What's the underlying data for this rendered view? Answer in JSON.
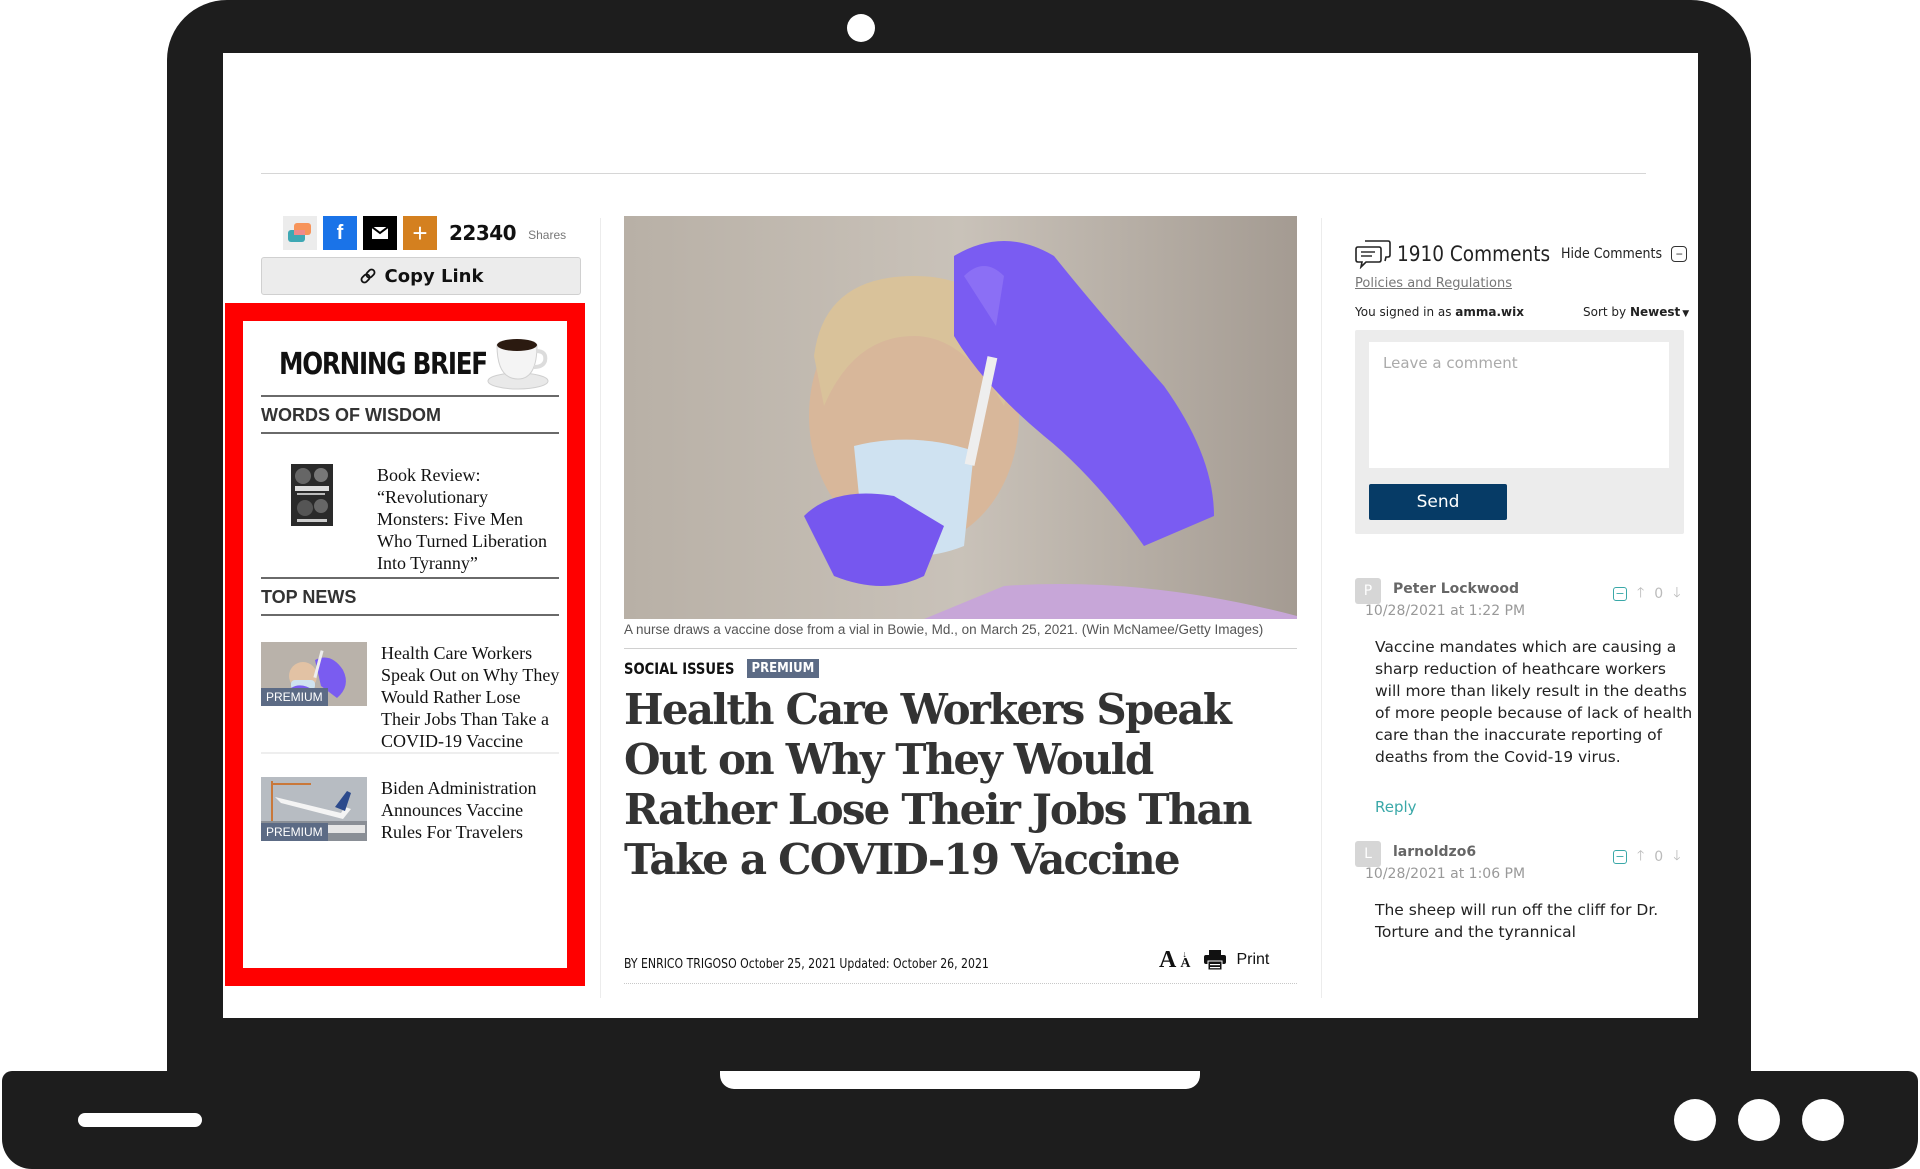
{
  "share": {
    "count": "22340",
    "label": "Shares",
    "copy_link_label": "Copy Link",
    "buttons": [
      "share-multi",
      "facebook",
      "email",
      "more"
    ],
    "facebook_glyph": "f",
    "more_glyph": "+"
  },
  "morning_brief": {
    "title": "MORNING BRIEF",
    "sections": [
      {
        "title": "WORDS OF WISDOM",
        "items": [
          {
            "title": "Book Review: “Revolutionary Monsters: Five Men Who Turned Liberation Into Tyranny”",
            "thumb": "book-cover",
            "premium": false
          }
        ]
      },
      {
        "title": "TOP NEWS",
        "items": [
          {
            "title": "Health Care Workers Speak Out on Why They Would Rather Lose Their Jobs Than Take a COVID-19 Vaccine",
            "thumb": "nurse-vaccine",
            "premium": true,
            "badge": "PREMIUM"
          },
          {
            "title": "Biden Administration Announces Vaccine Rules For Travelers",
            "thumb": "airplane",
            "premium": true,
            "badge": "PREMIUM"
          }
        ]
      }
    ]
  },
  "article": {
    "image_caption": "A nurse draws a vaccine dose from a vial in Bowie, Md., on March 25, 2021. (Win McNamee/Getty Images)",
    "category": "SOCIAL ISSUES",
    "badge": "PREMIUM",
    "headline": "Health Care Workers Speak Out on Why They Would Rather Lose Their Jobs Than Take a COVID-19 Vaccine",
    "byline": "BY ENRICO TRIGOSO  October 25, 2021 Updated: October 26, 2021",
    "font_size_tool_label": "A",
    "print_label": "Print"
  },
  "comments": {
    "count_label": "1910 Comments",
    "hide_label": "Hide Comments",
    "policies_link": "Policies and Regulations",
    "signed_in_prefix": "You signed in as ",
    "username": "amma.wix",
    "sort_prefix": "Sort by ",
    "sort_value": "Newest",
    "input_placeholder": "Leave a comment",
    "send_label": "Send",
    "list": [
      {
        "avatar_letter": "P",
        "author": "Peter Lockwood",
        "date": "10/28/2021 at 1:22 PM",
        "votes": "0",
        "body": "Vaccine mandates which are causing a sharp reduction of heathcare workers will more than likely result in the deaths of more people because of lack of health care than the inaccurate reporting of deaths from the Covid-19 virus.",
        "reply_label": "Reply"
      },
      {
        "avatar_letter": "L",
        "author": "larnoldzo6",
        "date": "10/28/2021 at 1:06 PM",
        "votes": "0",
        "body": "The sheep will run off the cliff for Dr. Torture and the tyrannical"
      }
    ]
  },
  "colors": {
    "highlight": "#ff0000",
    "premium_badge": "#5c6b85",
    "send_button": "#063b66",
    "accent_teal": "#3aa8a8",
    "facebook": "#1a73e8",
    "more_button": "#d4801f",
    "laptop_frame": "#1d1d1d"
  }
}
